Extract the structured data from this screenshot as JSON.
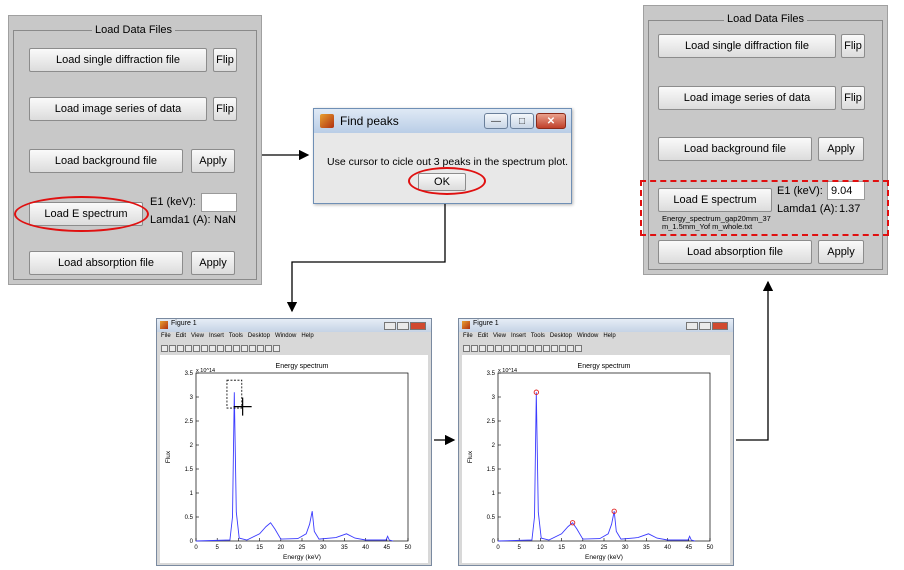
{
  "left_panel": {
    "title": "Load Data Files",
    "load_single": "Load single diffraction file",
    "flip1": "Flip",
    "load_series": "Load image series of data",
    "flip2": "Flip",
    "load_background": "Load background file",
    "apply1": "Apply",
    "load_e_spectrum": "Load E spectrum",
    "e1_label": "E1 (keV):",
    "e1_value": "",
    "lamda_label": "Lamda1 (A):",
    "lamda_value": "NaN",
    "load_absorption": "Load absorption file",
    "apply2": "Apply"
  },
  "right_panel": {
    "title": "Load Data Files",
    "load_single": "Load single diffraction file",
    "flip1": "Flip",
    "load_series": "Load image series of data",
    "flip2": "Flip",
    "load_background": "Load background file",
    "apply1": "Apply",
    "load_e_spectrum": "Load E spectrum",
    "e1_label": "E1 (keV):",
    "e1_value": "9.04",
    "lamda_label": "Lamda1 (A):",
    "lamda_value": "1.37",
    "file_name": "Energy_spectrum_gap20mm_37m_1.5mm_Yof m_whole.txt",
    "load_absorption": "Load absorption file",
    "apply2": "Apply"
  },
  "dialog": {
    "title": "Find peaks",
    "message": "Use cursor to cicle out 3 peaks in the spectrum plot.",
    "ok": "OK",
    "minimize": "—",
    "maximize": "□",
    "close": "✕"
  },
  "figure_left": {
    "title": "Figure 1",
    "menu": [
      "File",
      "Edit",
      "View",
      "Insert",
      "Tools",
      "Desktop",
      "Window",
      "Help"
    ]
  },
  "figure_right": {
    "title": "Figure 1",
    "menu": [
      "File",
      "Edit",
      "View",
      "Insert",
      "Tools",
      "Desktop",
      "Window",
      "Help"
    ]
  },
  "chart_data": [
    {
      "type": "line",
      "title": "Energy spectrum",
      "xlabel": "Energy (keV)",
      "ylabel": "Flux",
      "y_multiplier": "x 10^14",
      "xlim": [
        0,
        50
      ],
      "ylim": [
        0,
        3.5
      ],
      "xticks": [
        "0",
        "5",
        "10",
        "15",
        "20",
        "25",
        "30",
        "35",
        "40",
        "45",
        "50"
      ],
      "yticks": [
        "0",
        "0.5",
        "1",
        "1.5",
        "2",
        "2.5",
        "3",
        "3.5"
      ],
      "x": [
        0,
        8.0,
        8.6,
        9.04,
        9.5,
        10.2,
        12.0,
        15.0,
        16.5,
        17.6,
        18.6,
        20.0,
        24.0,
        26.0,
        26.8,
        27.4,
        27.9,
        29.0,
        33.0,
        35.5,
        37.5,
        40.0,
        44.8,
        45.2,
        45.6,
        46.5
      ],
      "y": [
        0,
        0.02,
        0.5,
        3.1,
        0.6,
        0.06,
        0.02,
        0.15,
        0.3,
        0.38,
        0.25,
        0.04,
        0.05,
        0.15,
        0.35,
        0.62,
        0.2,
        0.04,
        0.07,
        0.15,
        0.06,
        0.02,
        0.02,
        0.1,
        0.02,
        0
      ],
      "markers": []
    },
    {
      "type": "line",
      "title": "Energy spectrum",
      "xlabel": "Energy (keV)",
      "ylabel": "Flux",
      "y_multiplier": "x 10^14",
      "xlim": [
        0,
        50
      ],
      "ylim": [
        0,
        3.5
      ],
      "xticks": [
        "0",
        "5",
        "10",
        "15",
        "20",
        "25",
        "30",
        "35",
        "40",
        "45",
        "50"
      ],
      "yticks": [
        "0",
        "0.5",
        "1",
        "1.5",
        "2",
        "2.5",
        "3",
        "3.5"
      ],
      "x": [
        0,
        8.0,
        8.6,
        9.04,
        9.5,
        10.2,
        12.0,
        15.0,
        16.5,
        17.6,
        18.6,
        20.0,
        24.0,
        26.0,
        26.8,
        27.4,
        27.9,
        29.0,
        33.0,
        35.5,
        37.5,
        40.0,
        44.8,
        45.2,
        45.6,
        46.5
      ],
      "y": [
        0,
        0.02,
        0.5,
        3.1,
        0.6,
        0.06,
        0.02,
        0.15,
        0.3,
        0.38,
        0.25,
        0.04,
        0.05,
        0.15,
        0.35,
        0.62,
        0.2,
        0.04,
        0.07,
        0.15,
        0.06,
        0.02,
        0.02,
        0.1,
        0.02,
        0
      ],
      "markers": [
        {
          "x": 9.04,
          "y": 3.1
        },
        {
          "x": 17.6,
          "y": 0.38
        },
        {
          "x": 27.4,
          "y": 0.62
        }
      ]
    }
  ],
  "colors": {
    "line": "#3b3bff",
    "marker": "#e02020",
    "highlight": "#e01010",
    "panel": "#c8c8c8"
  }
}
